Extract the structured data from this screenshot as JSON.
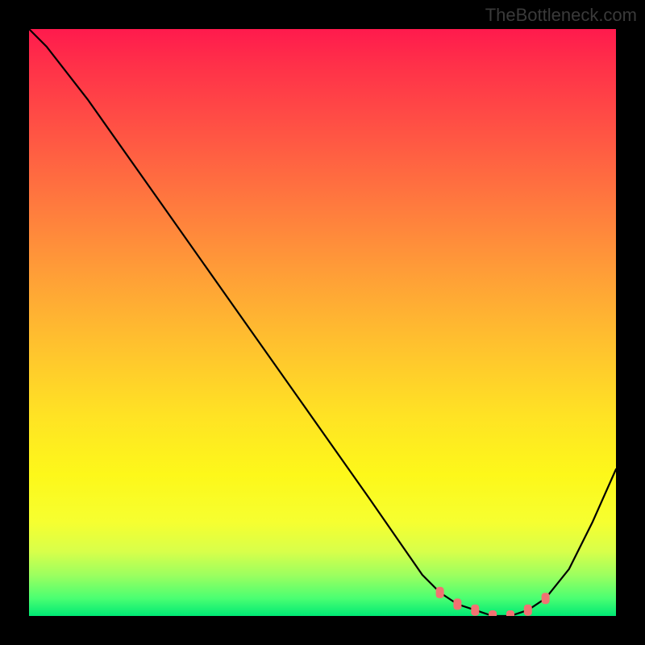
{
  "watermark": "TheBottleneck.com",
  "chart_data": {
    "type": "line",
    "title": "",
    "xlabel": "",
    "ylabel": "",
    "xlim": [
      0,
      100
    ],
    "ylim": [
      0,
      100
    ],
    "legend": false,
    "grid": false,
    "gradient_stops": [
      {
        "pct": 0,
        "color": "#ff1a4d"
      },
      {
        "pct": 6,
        "color": "#ff3049"
      },
      {
        "pct": 18,
        "color": "#ff5544"
      },
      {
        "pct": 30,
        "color": "#ff7a3e"
      },
      {
        "pct": 42,
        "color": "#ff9f37"
      },
      {
        "pct": 54,
        "color": "#ffc22e"
      },
      {
        "pct": 66,
        "color": "#ffe324"
      },
      {
        "pct": 76,
        "color": "#fdf81a"
      },
      {
        "pct": 84,
        "color": "#f6ff30"
      },
      {
        "pct": 89,
        "color": "#d8ff4a"
      },
      {
        "pct": 93,
        "color": "#9dff5f"
      },
      {
        "pct": 97,
        "color": "#4aff72"
      },
      {
        "pct": 100,
        "color": "#00e874"
      }
    ],
    "series": [
      {
        "name": "bottleneck-curve",
        "x": [
          0,
          3,
          10,
          22,
          34,
          46,
          58,
          67,
          70,
          73,
          76,
          79,
          82,
          85,
          88,
          92,
          96,
          100
        ],
        "y": [
          100,
          97,
          88,
          71,
          54,
          37,
          20,
          7,
          4,
          2,
          1,
          0,
          0,
          1,
          3,
          8,
          16,
          25
        ]
      }
    ],
    "markers": {
      "name": "highlighted-range",
      "color": "#f27272",
      "points": [
        {
          "x": 70,
          "y": 4
        },
        {
          "x": 73,
          "y": 2
        },
        {
          "x": 76,
          "y": 1
        },
        {
          "x": 79,
          "y": 0
        },
        {
          "x": 82,
          "y": 0
        },
        {
          "x": 85,
          "y": 1
        },
        {
          "x": 88,
          "y": 3
        }
      ]
    }
  }
}
